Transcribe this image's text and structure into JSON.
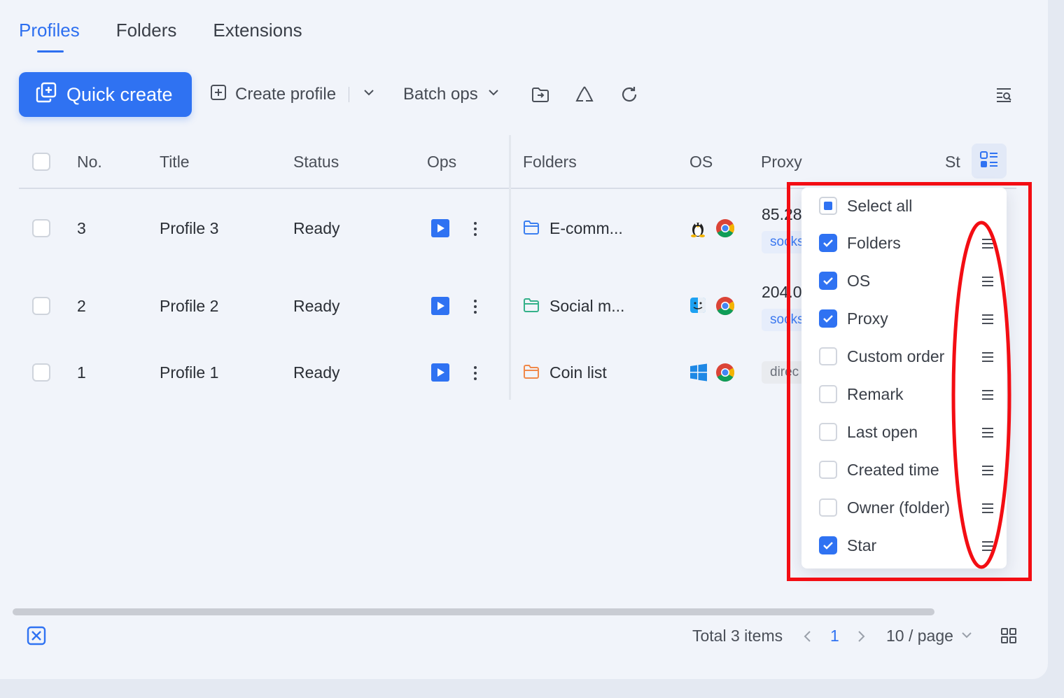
{
  "tabs": [
    {
      "label": "Profiles",
      "active": true
    },
    {
      "label": "Folders",
      "active": false
    },
    {
      "label": "Extensions",
      "active": false
    }
  ],
  "toolbar": {
    "quick_create": "Quick create",
    "create_profile": "Create profile",
    "batch_ops": "Batch ops",
    "icons": [
      "folder-move-icon",
      "recycle-icon",
      "refresh-icon",
      "filter-search-icon"
    ]
  },
  "table": {
    "headers": {
      "no": "No.",
      "title": "Title",
      "status": "Status",
      "ops": "Ops",
      "folders": "Folders",
      "os": "OS",
      "proxy": "Proxy",
      "star": "St"
    },
    "rows": [
      {
        "no": "3",
        "title": "Profile 3",
        "status": "Ready",
        "folder": "E-comm...",
        "folder_color": "#3b7ff0",
        "os": "linux",
        "proxy_ip": "85.28",
        "proxy_type": "socks"
      },
      {
        "no": "2",
        "title": "Profile 2",
        "status": "Ready",
        "folder": "Social m...",
        "folder_color": "#35b18a",
        "os": "macos",
        "proxy_ip": "204.0",
        "proxy_type": "socks"
      },
      {
        "no": "1",
        "title": "Profile 1",
        "status": "Ready",
        "folder": "Coin list",
        "folder_color": "#f0894a",
        "os": "windows",
        "proxy_ip": "",
        "proxy_type": "direc"
      }
    ]
  },
  "column_menu": {
    "select_all": "Select all",
    "options": [
      {
        "label": "Folders",
        "checked": true
      },
      {
        "label": "OS",
        "checked": true
      },
      {
        "label": "Proxy",
        "checked": true
      },
      {
        "label": "Custom order",
        "checked": false
      },
      {
        "label": "Remark",
        "checked": false
      },
      {
        "label": "Last open",
        "checked": false
      },
      {
        "label": "Created time",
        "checked": false
      },
      {
        "label": "Owner (folder)",
        "checked": false
      },
      {
        "label": "Star",
        "checked": true
      }
    ]
  },
  "footer": {
    "total": "Total 3 items",
    "current_page": "1",
    "page_size": "10 / page"
  },
  "colors": {
    "accent": "#2f72f2",
    "highlight": "#f30d13"
  }
}
